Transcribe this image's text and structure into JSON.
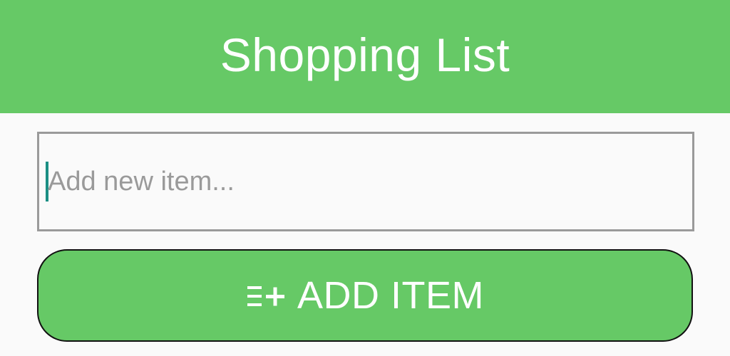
{
  "header": {
    "title": "Shopping List"
  },
  "input": {
    "placeholder": "Add new item...",
    "value": ""
  },
  "add_button": {
    "label": "ADD ITEM",
    "icon": "playlist-add-icon"
  },
  "colors": {
    "primary": "#66c966",
    "background": "#fafafa",
    "input_border": "#9a9a9a",
    "caret": "#1b8f84",
    "text_on_primary": "#ffffff"
  }
}
